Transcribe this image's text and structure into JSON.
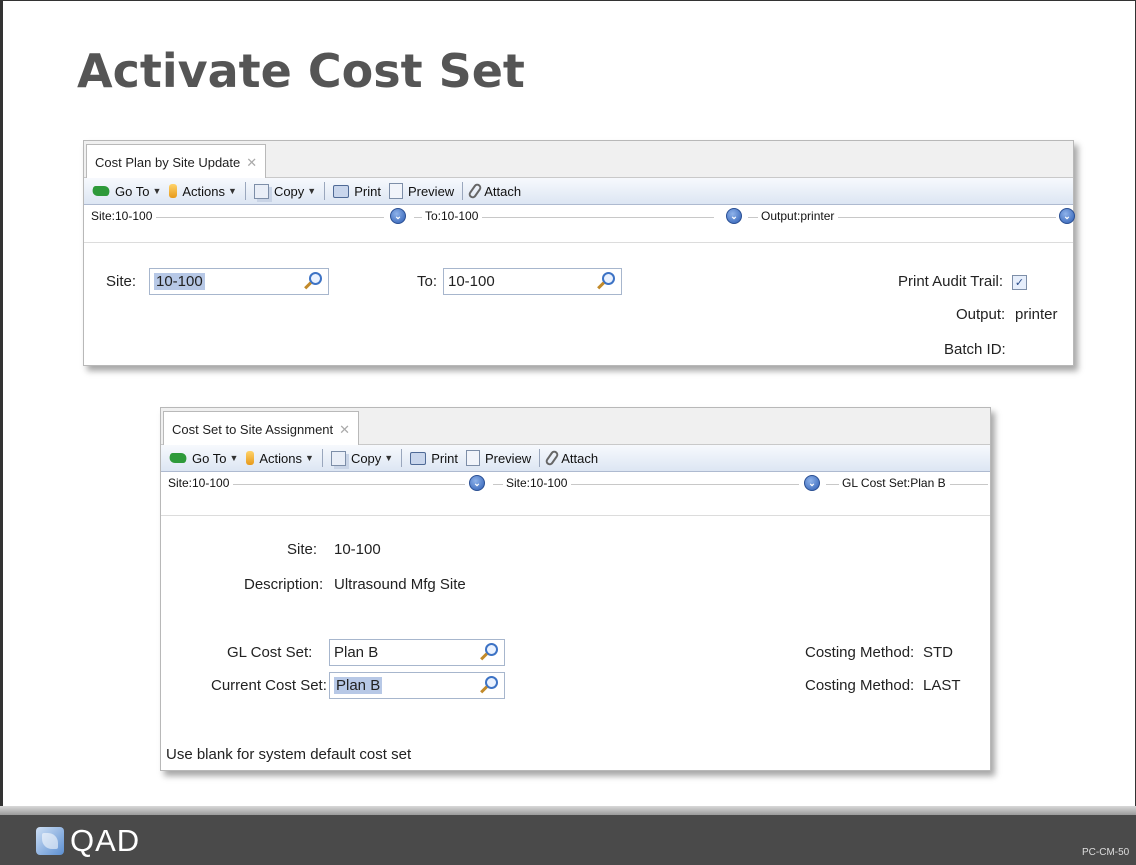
{
  "slide": {
    "title": "Activate Cost Set",
    "logo_text": "QAD",
    "code": "PC-CM-50"
  },
  "toolbar": {
    "goto_label": "Go To",
    "actions_label": "Actions",
    "copy_label": "Copy",
    "print_label": "Print",
    "preview_label": "Preview",
    "attach_label": "Attach"
  },
  "window1": {
    "tab_title": "Cost Plan by Site Update",
    "filters": [
      "Site:10-100",
      "To:10-100",
      "Output:printer"
    ],
    "site_label": "Site:",
    "site_value": "10-100",
    "to_label": "To:",
    "to_value": "10-100",
    "print_audit_label": "Print Audit Trail:",
    "print_audit_checked": true,
    "output_label": "Output:",
    "output_value": "printer",
    "batch_label": "Batch ID:"
  },
  "window2": {
    "tab_title": "Cost Set to Site Assignment",
    "filters": [
      "Site:10-100",
      "Site:10-100",
      "GL Cost Set:Plan B"
    ],
    "site_label": "Site:",
    "site_value": "10-100",
    "description_label": "Description:",
    "description_value": "Ultrasound Mfg Site",
    "gl_cost_set_label": "GL Cost Set:",
    "gl_cost_set_value": "Plan B",
    "current_cost_set_label": "Current Cost Set:",
    "current_cost_set_value": "Plan B",
    "costing_method_label_1": "Costing Method:",
    "costing_method_value_1": "STD",
    "costing_method_label_2": "Costing Method:",
    "costing_method_value_2": "LAST",
    "hint": "Use blank for system default cost set"
  }
}
